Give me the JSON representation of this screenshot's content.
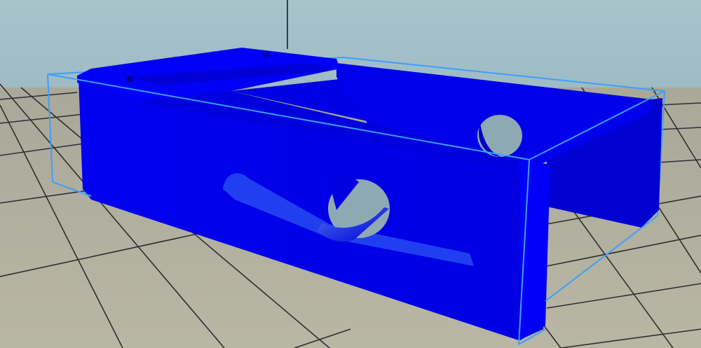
{
  "viewport": {
    "sky_top_color": "#a9c3cb",
    "sky_bottom_color": "#7fa3b0",
    "floor_color": "#b1ae9e",
    "grid_line_color": "#2b2b2b",
    "model_color": "#0000f0",
    "bounding_box_color": "#3aa0ff",
    "model_object": "3d-printed-bracket-part",
    "bounding_box_shown": true
  }
}
